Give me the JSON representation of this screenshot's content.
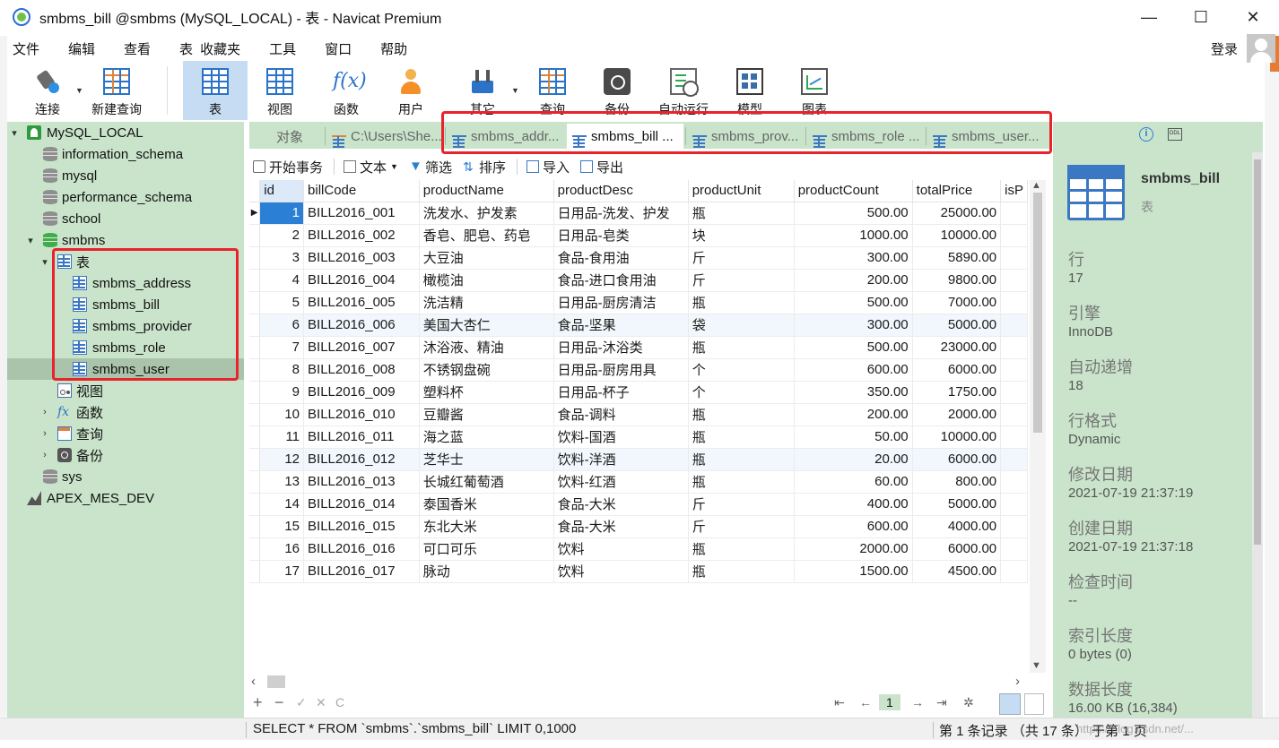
{
  "window": {
    "title": "smbms_bill @smbms (MySQL_LOCAL) - 表 - Navicat Premium",
    "controls": [
      "—",
      "☐",
      "✕"
    ]
  },
  "menu": {
    "items": [
      "文件",
      "编辑",
      "查看",
      "表",
      "收藏夹",
      "工具",
      "窗口",
      "帮助"
    ],
    "login": "登录"
  },
  "toolbar": {
    "connect": "连接",
    "new_query": "新建查询",
    "table": "表",
    "view": "视图",
    "function": "函数",
    "user": "用户",
    "other": "其它",
    "query": "查询",
    "backup": "备份",
    "auto_run": "自动运行",
    "model": "模型",
    "chart": "图表"
  },
  "tree": {
    "connection": "MySQL_LOCAL",
    "databases": [
      "information_schema",
      "mysql",
      "performance_schema",
      "school"
    ],
    "active_db": "smbms",
    "tables_node": "表",
    "tables": [
      "smbms_address",
      "smbms_bill",
      "smbms_provider",
      "smbms_role",
      "smbms_user"
    ],
    "views_node": "视图",
    "functions_node": "函数",
    "queries_node": "查询",
    "backups_node": "备份",
    "sys_db": "sys",
    "other_connection": "APEX_MES_DEV"
  },
  "tabs": {
    "objects": "对象",
    "path_tab": "C:\\Users\\She...",
    "table_tabs": [
      "smbms_addr...",
      "smbms_bill ...",
      "smbms_prov...",
      "smbms_role ...",
      "smbms_user..."
    ]
  },
  "objbar": {
    "begin_tx": "开始事务",
    "text": "文本",
    "filter": "筛选",
    "sort": "排序",
    "import": "导入",
    "export": "导出"
  },
  "grid": {
    "columns": [
      "id",
      "billCode",
      "productName",
      "productDesc",
      "productUnit",
      "productCount",
      "totalPrice",
      "isP"
    ],
    "rows": [
      [
        "1",
        "BILL2016_001",
        "洗发水、护发素",
        "日用品-洗发、护发",
        "瓶",
        "500.00",
        "25000.00"
      ],
      [
        "2",
        "BILL2016_002",
        "香皂、肥皂、药皂",
        "日用品-皂类",
        "块",
        "1000.00",
        "10000.00"
      ],
      [
        "3",
        "BILL2016_003",
        "大豆油",
        "食品-食用油",
        "斤",
        "300.00",
        "5890.00"
      ],
      [
        "4",
        "BILL2016_004",
        "橄榄油",
        "食品-进口食用油",
        "斤",
        "200.00",
        "9800.00"
      ],
      [
        "5",
        "BILL2016_005",
        "洗洁精",
        "日用品-厨房清洁",
        "瓶",
        "500.00",
        "7000.00"
      ],
      [
        "6",
        "BILL2016_006",
        "美国大杏仁",
        "食品-坚果",
        "袋",
        "300.00",
        "5000.00"
      ],
      [
        "7",
        "BILL2016_007",
        "沐浴液、精油",
        "日用品-沐浴类",
        "瓶",
        "500.00",
        "23000.00"
      ],
      [
        "8",
        "BILL2016_008",
        "不锈钢盘碗",
        "日用品-厨房用具",
        "个",
        "600.00",
        "6000.00"
      ],
      [
        "9",
        "BILL2016_009",
        "塑料杯",
        "日用品-杯子",
        "个",
        "350.00",
        "1750.00"
      ],
      [
        "10",
        "BILL2016_010",
        "豆瓣酱",
        "食品-调料",
        "瓶",
        "200.00",
        "2000.00"
      ],
      [
        "11",
        "BILL2016_011",
        "海之蓝",
        "饮料-国酒",
        "瓶",
        "50.00",
        "10000.00"
      ],
      [
        "12",
        "BILL2016_012",
        "芝华士",
        "饮料-洋酒",
        "瓶",
        "20.00",
        "6000.00"
      ],
      [
        "13",
        "BILL2016_013",
        "长城红葡萄酒",
        "饮料-红酒",
        "瓶",
        "60.00",
        "800.00"
      ],
      [
        "14",
        "BILL2016_014",
        "泰国香米",
        "食品-大米",
        "斤",
        "400.00",
        "5000.00"
      ],
      [
        "15",
        "BILL2016_015",
        "东北大米",
        "食品-大米",
        "斤",
        "600.00",
        "4000.00"
      ],
      [
        "16",
        "BILL2016_016",
        "可口可乐",
        "饮料",
        "瓶",
        "2000.00",
        "6000.00"
      ],
      [
        "17",
        "BILL2016_017",
        "脉动",
        "饮料",
        "瓶",
        "1500.00",
        "4500.00"
      ]
    ]
  },
  "nav": {
    "add": "+",
    "remove": "−",
    "apply": "✓",
    "discard": "✕",
    "refresh": "C",
    "first": "⇤",
    "prev": "←",
    "page": "1",
    "next": "→",
    "last": "⇥",
    "settings": "✲"
  },
  "info": {
    "name": "smbms_bill",
    "type": "表",
    "props": [
      {
        "label": "行",
        "value": "17"
      },
      {
        "label": "引擎",
        "value": "InnoDB"
      },
      {
        "label": "自动递增",
        "value": "18"
      },
      {
        "label": "行格式",
        "value": "Dynamic"
      },
      {
        "label": "修改日期",
        "value": "2021-07-19 21:37:19"
      },
      {
        "label": "创建日期",
        "value": "2021-07-19 21:37:18"
      },
      {
        "label": "检查时间",
        "value": "--"
      },
      {
        "label": "索引长度",
        "value": "0 bytes (0)"
      },
      {
        "label": "数据长度",
        "value": "16.00 KB (16,384)"
      }
    ]
  },
  "status": {
    "sql": "SELECT * FROM `smbms`.`smbms_bill` LIMIT 0,1000",
    "record": "第 1 条记录 （共 17 条） 于第 1 页",
    "watermark": "https://blog.csdn.net/..."
  },
  "colors": {
    "sidebar_bg": "#c9e4cb",
    "selection_blue": "#2b7fd4",
    "annotation_red": "#e8232b",
    "active_tool": "#c6dcf2"
  }
}
